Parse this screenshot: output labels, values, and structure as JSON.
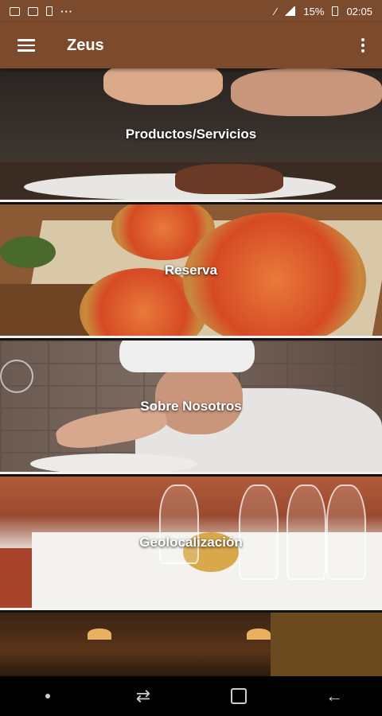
{
  "status_bar": {
    "battery": "15%",
    "time": "02:05",
    "overflow": "···"
  },
  "app_bar": {
    "title": "Zeus"
  },
  "tiles": [
    {
      "label": "Productos/Servicios"
    },
    {
      "label": "Reserva"
    },
    {
      "label": "Sobre Nosotros"
    },
    {
      "label": "Geolocalización"
    }
  ],
  "colors": {
    "app_bar": "#7c4a2c",
    "nav_bar": "#000000"
  },
  "icons": {
    "menu": "hamburger-menu-icon",
    "overflow": "more-vert-icon",
    "nav_back": "back-arrow-icon",
    "nav_home": "home-icon",
    "nav_recents": "recents-icon"
  }
}
